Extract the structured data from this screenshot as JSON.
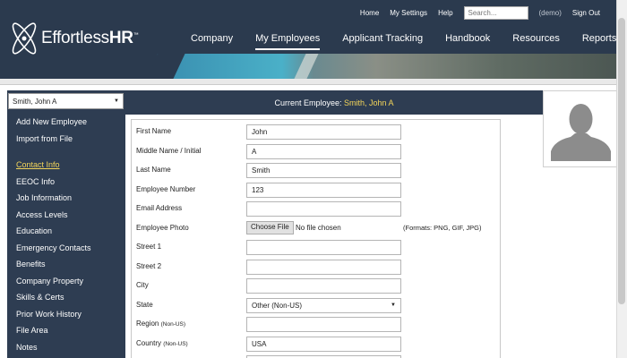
{
  "brand": {
    "name_light": "Effortless",
    "name_bold": "HR",
    "tm": "™"
  },
  "toplinks": {
    "home": "Home",
    "settings": "My Settings",
    "help": "Help",
    "search_placeholder": "Search...",
    "demo": "(demo)",
    "signout": "Sign Out"
  },
  "nav": [
    "Company",
    "My Employees",
    "Applicant Tracking",
    "Handbook",
    "Resources",
    "Reports"
  ],
  "nav_active": "My Employees",
  "employee_select": {
    "value": "Smith, John A"
  },
  "current": {
    "label": "Current Employee:",
    "name": "Smith, John A"
  },
  "sidebar": {
    "top": [
      "Add New Employee",
      "Import from File"
    ],
    "sections": [
      "Contact Info",
      "EEOC Info",
      "Job Information",
      "Access Levels",
      "Education",
      "Emergency Contacts",
      "Benefits",
      "Company Property",
      "Skills & Certs",
      "Prior Work History",
      "File Area",
      "Notes"
    ],
    "current": "Contact Info"
  },
  "form": {
    "first_name": {
      "label": "First Name",
      "value": "John"
    },
    "middle_name": {
      "label": "Middle Name / Initial",
      "value": "A"
    },
    "last_name": {
      "label": "Last Name",
      "value": "Smith"
    },
    "employee_number": {
      "label": "Employee Number",
      "value": "123"
    },
    "email": {
      "label": "Email Address",
      "value": ""
    },
    "photo": {
      "label": "Employee Photo",
      "button": "Choose File",
      "status": "No file chosen",
      "hint": "(Formats: PNG, GIF, JPG)"
    },
    "street1": {
      "label": "Street 1",
      "value": ""
    },
    "street2": {
      "label": "Street 2",
      "value": ""
    },
    "city": {
      "label": "City",
      "value": ""
    },
    "state": {
      "label": "State",
      "value": "Other (Non-US)"
    },
    "region": {
      "label": "Region",
      "sub": "(Non-US)",
      "value": ""
    },
    "country": {
      "label": "Country",
      "sub": "(Non-US)",
      "value": "USA"
    }
  }
}
